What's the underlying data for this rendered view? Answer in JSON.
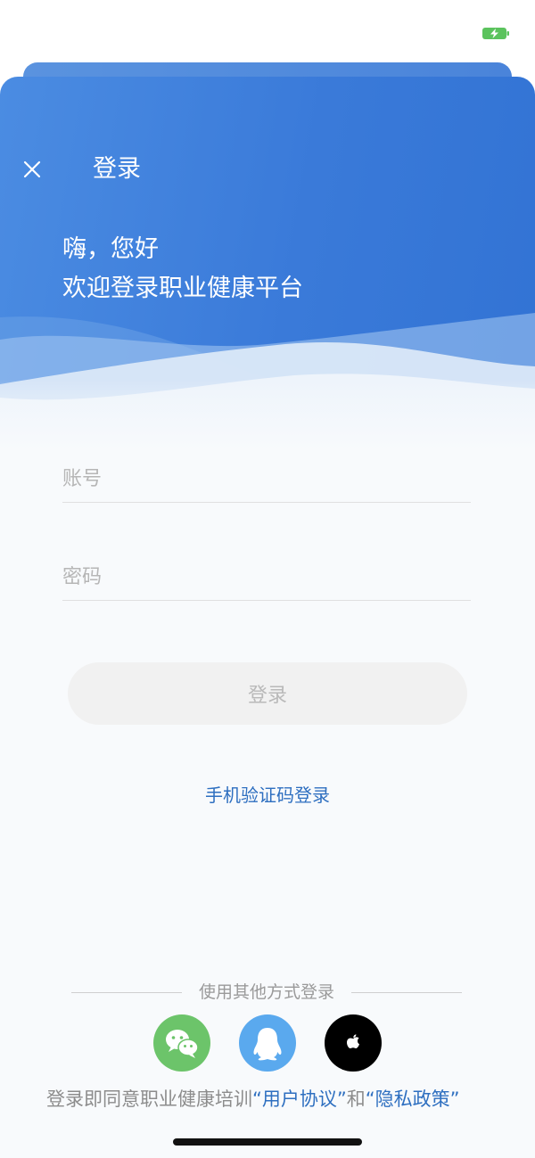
{
  "header": {
    "title": "登录",
    "greeting_line1": "嗨，您好",
    "greeting_line2": "欢迎登录职业健康平台"
  },
  "form": {
    "account_placeholder": "账号",
    "account_value": "",
    "password_placeholder": "密码",
    "password_value": "",
    "login_button_label": "登录",
    "sms_login_link": "手机验证码登录"
  },
  "other_login": {
    "divider_label": "使用其他方式登录",
    "methods": [
      {
        "name": "wechat",
        "icon": "wechat-icon",
        "color": "#6cc46a"
      },
      {
        "name": "qq",
        "icon": "qq-penguin-icon",
        "color": "#5aa9ee"
      },
      {
        "name": "apple",
        "icon": "apple-icon",
        "color": "#000000"
      }
    ]
  },
  "agreement": {
    "prefix": "登录即同意职业健康培训",
    "user_agreement": "“用户协议”",
    "connector": "和",
    "privacy_policy": "“隐私政策”"
  },
  "colors": {
    "brand_blue": "#3a7ad9",
    "link_blue": "#2e6fc0",
    "battery_green": "#5bc35d"
  }
}
